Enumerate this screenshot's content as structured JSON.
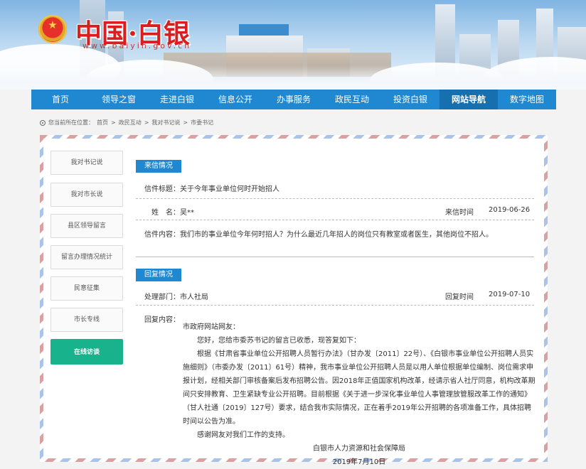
{
  "header": {
    "site_title": "中国·白银",
    "site_url": "www.baiyin.gov.cn",
    "emblem_icon": "national-emblem-icon"
  },
  "nav": {
    "items": [
      {
        "label": "首页"
      },
      {
        "label": "领导之窗"
      },
      {
        "label": "走进白银"
      },
      {
        "label": "信息公开"
      },
      {
        "label": "办事服务"
      },
      {
        "label": "政民互动"
      },
      {
        "label": "投资白银"
      },
      {
        "label": "网站导航"
      },
      {
        "label": "数字地图"
      }
    ],
    "active": "网站导航"
  },
  "breadcrumb": {
    "prefix": "您当前所在位置：",
    "items": [
      "首页",
      "政民互动",
      "我对书记说",
      "市委书记"
    ],
    "separator": ">"
  },
  "sidebar": {
    "items": [
      {
        "label": "我对书记说"
      },
      {
        "label": "我对市长说"
      },
      {
        "label": "县区领导留言"
      },
      {
        "label": "留言办理情况统计"
      },
      {
        "label": "民意征集"
      },
      {
        "label": "市长专线"
      },
      {
        "label": "在线访谈"
      }
    ],
    "active": "在线访谈"
  },
  "letter": {
    "section_title": "来信情况",
    "subject_label": "信件标题：",
    "subject": "关于今年事业单位何时开始招人",
    "name_label": "姓　名：",
    "name": "吴**",
    "date_label": "来信时间",
    "date": "2019-06-26",
    "content_label": "信件内容：",
    "content": "我们市的事业单位今年何时招人？为什么最近几年招人的岗位只有教室或者医生，其他岗位不招人。"
  },
  "reply": {
    "section_title": "回复情况",
    "dept_label": "处理部门：",
    "dept": "市人社局",
    "date_label": "回复时间",
    "date": "2019-07-10",
    "content_label": "回复内容：",
    "greeting": "市政府网站网友：",
    "line1": "您好，您给市委苏书记的留言已收悉，现答复如下：",
    "body": "根据《甘肃省事业单位公开招聘人员暂行办法》（甘办发〔2011〕22号）、《白银市事业单位公开招聘人员实施细则》（市委办发〔2011〕61号）精神，我市事业单位公开招聘人员是以用人单位根据单位编制、岗位需求申报计划，经相关部门审核备案后发布招聘公告。因2018年正值国家机构改革，经请示省人社厅同意，机构改革期间只安排教育、卫生紧缺专业公开招聘。目前根据《关于进一步深化事业单位人事管理放管服改革工作的通知》（甘人社通〔2019〕127号）要求，结合我市实际情况，正在着手2019年公开招聘的各项准备工作，具体招聘时间以公告为准。",
    "thanks": "感谢网友对我们工作的支持。",
    "signature": "白银市人力资源和社会保障局",
    "sign_date": "2019年7月10日"
  }
}
